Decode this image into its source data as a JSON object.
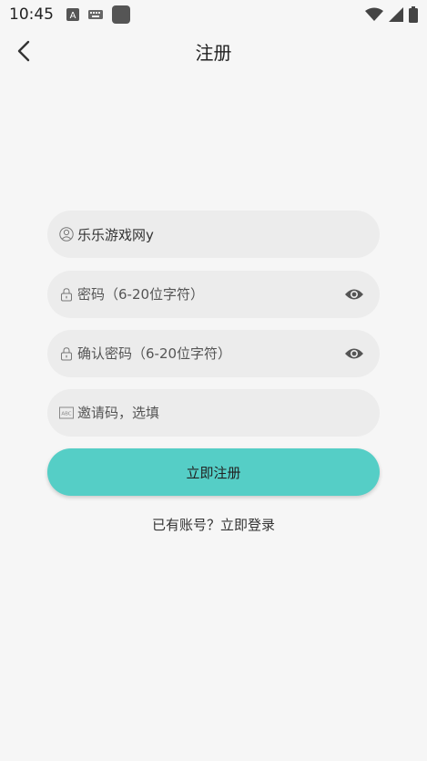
{
  "status_bar": {
    "time": "10:45",
    "icons": [
      "a-notification-icon",
      "keyboard-icon",
      "app-square-icon",
      "wifi-icon",
      "signal-icon",
      "battery-icon"
    ]
  },
  "header": {
    "title": "注册"
  },
  "form": {
    "username": {
      "value": "乐乐游戏网y",
      "icon": "user-icon"
    },
    "password": {
      "placeholder": "密码（6-20位字符）",
      "icon": "lock-icon",
      "toggle_icon": "eye-icon"
    },
    "confirm_password": {
      "placeholder": "确认密码（6-20位字符）",
      "icon": "lock-icon",
      "toggle_icon": "eye-icon"
    },
    "invite_code": {
      "placeholder": "邀请码，选填",
      "icon": "invite-code-icon"
    },
    "submit_label": "立即注册",
    "login_link": "已有账号？立即登录"
  },
  "colors": {
    "accent": "#55cec6",
    "field_bg": "#ececec",
    "page_bg": "#f6f6f6"
  }
}
